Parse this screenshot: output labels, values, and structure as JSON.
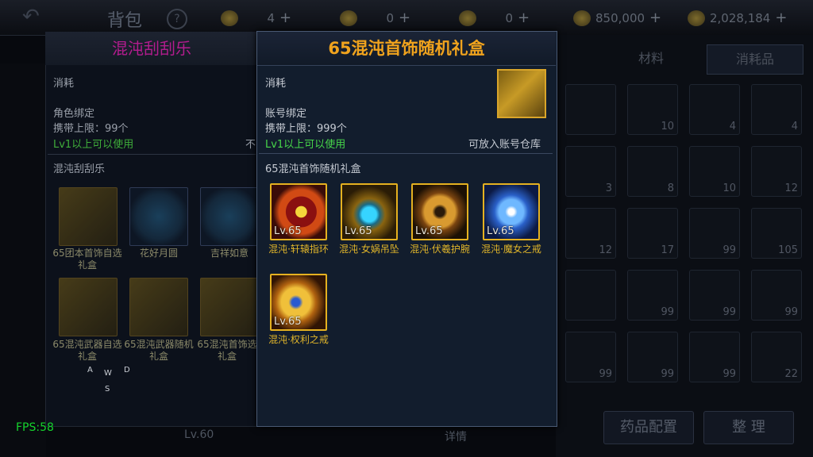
{
  "background": {
    "title": "背包",
    "help": "?",
    "resources": [
      {
        "icon": "coin-icon",
        "value": "4"
      },
      {
        "icon": "ticket-icon",
        "value": "0"
      },
      {
        "icon": "gem-icon",
        "value": "0"
      },
      {
        "icon": "gold-icon",
        "value": "850,000"
      },
      {
        "icon": "bag-gold-icon",
        "value": "2,028,184"
      }
    ],
    "tabs": [
      "材料",
      "消耗品"
    ],
    "grid_counts": [
      "",
      "10",
      "4",
      "4",
      "3",
      "8",
      "10",
      "12",
      "12",
      "17",
      "99",
      "105",
      "",
      "99",
      "99",
      "99",
      "99",
      "99",
      "99",
      "22"
    ],
    "buttons": {
      "potion": "药品配置",
      "sort": "整 理",
      "detail": "详情",
      "level": "Lv.60"
    },
    "fps": "FPS:58",
    "wasd": {
      "w": "W",
      "a": "A",
      "s": "S",
      "d": "D"
    }
  },
  "left_panel": {
    "title": "混沌刮刮乐",
    "type": "消耗",
    "bind": "角色绑定",
    "limit": "携带上限：99个",
    "req": "Lv1以上可以使用",
    "req_suffix": "不",
    "section": "混沌刮刮乐",
    "items": [
      {
        "name": "65团本首饰自选礼盒",
        "kind": "box"
      },
      {
        "name": "花好月圆",
        "kind": "round"
      },
      {
        "name": "吉祥如意",
        "kind": "round"
      },
      {
        "name": "65混沌武器自选礼盒",
        "kind": "box"
      },
      {
        "name": "65混沌武器随机礼盒",
        "kind": "box"
      },
      {
        "name": "65混沌首饰选礼盒",
        "kind": "box"
      }
    ]
  },
  "popup": {
    "title": "65混沌首饰随机礼盒",
    "type": "消耗",
    "bind": "账号绑定",
    "limit": "携带上限：999个",
    "req": "Lv1以上可以使用",
    "storage": "可放入账号仓库",
    "contents_title": "65混沌首饰随机礼盒",
    "items": [
      {
        "level": "Lv.65",
        "name": "混沌·轩辕指环",
        "icon": "ring-icon"
      },
      {
        "level": "Lv.65",
        "name": "混沌·女娲吊坠",
        "icon": "pendant-icon"
      },
      {
        "level": "Lv.65",
        "name": "混沌·伏羲护腕",
        "icon": "bracer-icon"
      },
      {
        "level": "Lv.65",
        "name": "混沌·魔女之戒",
        "icon": "ring-icon"
      },
      {
        "level": "Lv.65",
        "name": "混沌·权利之戒",
        "icon": "ring-icon"
      }
    ]
  }
}
